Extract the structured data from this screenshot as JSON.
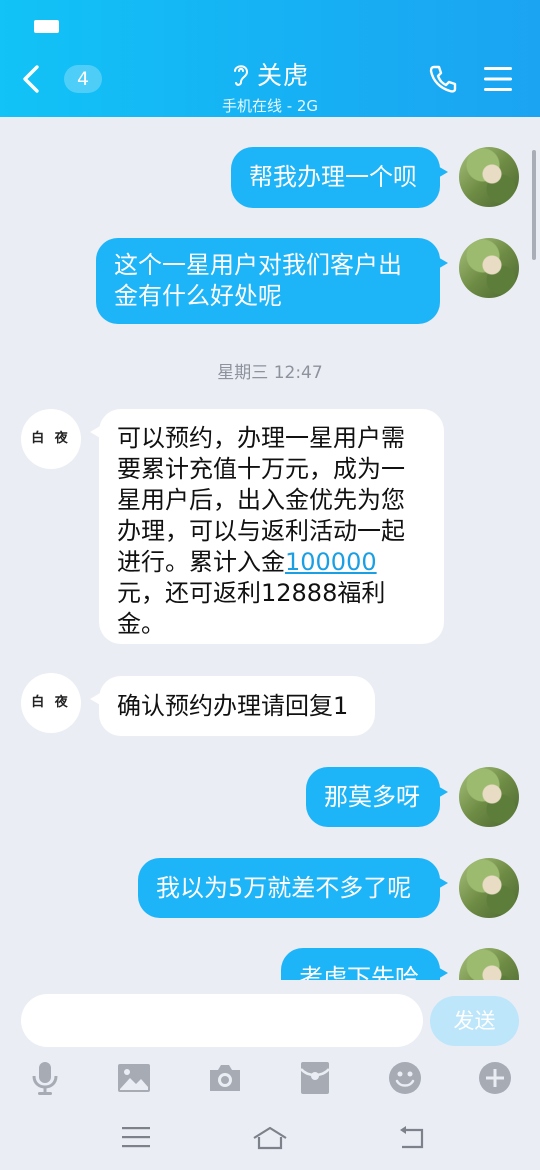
{
  "header": {
    "back_count": "4",
    "title": "关虎",
    "subtitle": "手机在线 - 2G"
  },
  "messages": [
    {
      "dir": "out",
      "text": "帮我办理一个呗"
    },
    {
      "dir": "out",
      "text_lines": [
        "这个一星用户对我们客户出",
        "金有什么好处呢"
      ]
    },
    {
      "dir": "in",
      "avatar": "白 夜",
      "text_lines": [
        "可以预约，办理一星用户需",
        "要累计充值十万元，成为一",
        "星用户后，出入金优先为您",
        "办理，可以与返利活动一起"
      ],
      "line5_prefix": "进行。累计入金",
      "line5_link": "100000",
      "text_lines_after": [
        "元，还可返利12888福利",
        "金。"
      ]
    },
    {
      "dir": "in",
      "avatar": "白 夜",
      "text": "确认预约办理请回复1"
    },
    {
      "dir": "out",
      "text": "那莫多呀"
    },
    {
      "dir": "out",
      "text": "我以为5万就差不多了呢"
    },
    {
      "dir": "out",
      "text": "考虑下先哈"
    }
  ],
  "timestamp": "星期三 12:47",
  "input": {
    "placeholder": "",
    "send_label": "发送"
  },
  "toolbar": [
    "microphone-icon",
    "image-icon",
    "camera-icon",
    "red-packet-icon",
    "emoji-icon",
    "plus-icon"
  ],
  "nav": [
    "menu-icon",
    "home-icon",
    "back-icon"
  ]
}
